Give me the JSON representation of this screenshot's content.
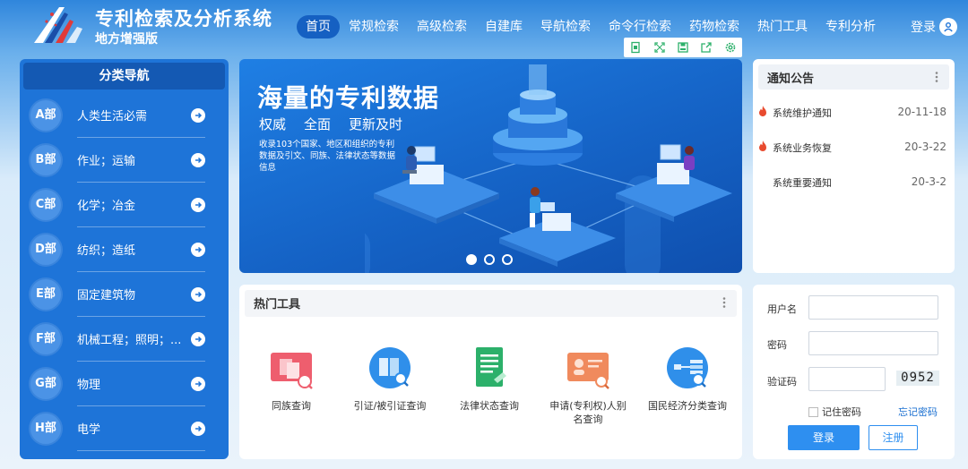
{
  "app": {
    "title": "专利检索及分析系统",
    "subtitle": "地方增强版"
  },
  "nav": {
    "items": [
      "首页",
      "常规检索",
      "高级检索",
      "自建库",
      "导航检索",
      "命令行检索",
      "药物检索",
      "热门工具",
      "专利分析"
    ],
    "active": "首页",
    "login_label": "登录"
  },
  "toolbar": {
    "icons": [
      "page-icon",
      "expand-icon",
      "save-icon",
      "share-icon",
      "settings-icon"
    ]
  },
  "sidebar": {
    "title": "分类导航",
    "items": [
      {
        "badge": "A部",
        "label": "人类生活必需"
      },
      {
        "badge": "B部",
        "label": "作业；运输"
      },
      {
        "badge": "C部",
        "label": "化学；冶金"
      },
      {
        "badge": "D部",
        "label": "纺织；造纸"
      },
      {
        "badge": "E部",
        "label": "固定建筑物"
      },
      {
        "badge": "F部",
        "label": "机械工程；照明；..."
      },
      {
        "badge": "G部",
        "label": "物理"
      },
      {
        "badge": "H部",
        "label": "电学"
      }
    ]
  },
  "banner": {
    "headline": "海量的专利数据",
    "tags": [
      "权威",
      "全面",
      "更新及时"
    ],
    "description": "收录103个国家、地区和组织的专利数据及引文、同族、法律状态等数据信息",
    "slides": 3,
    "active_slide": 1
  },
  "notice": {
    "title": "通知公告",
    "items": [
      {
        "text": "系统维护通知",
        "date": "20-11-18",
        "hot": true
      },
      {
        "text": "系统业务恢复",
        "date": "20-3-22",
        "hot": true
      },
      {
        "text": "系统重要通知",
        "date": "20-3-2",
        "hot": false
      }
    ]
  },
  "tools": {
    "title": "热门工具",
    "items": [
      {
        "label": "同族查询",
        "icon": "family-search-icon",
        "color": "#ee5e6e"
      },
      {
        "label": "引证/被引证查询",
        "icon": "citation-search-icon",
        "color": "#2f8fea"
      },
      {
        "label": "法律状态查询",
        "icon": "legal-status-icon",
        "color": "#2cb06a"
      },
      {
        "label": "申请(专利权)人别名查询",
        "icon": "applicant-alias-icon",
        "color": "#f08a5d"
      },
      {
        "label": "国民经济分类查询",
        "icon": "economy-class-icon",
        "color": "#2f8fea"
      }
    ]
  },
  "login": {
    "username_label": "用户名",
    "username_value": "",
    "password_label": "密码",
    "password_value": "",
    "captcha_label": "验证码",
    "captcha_value": "",
    "captcha_code": "0952",
    "remember_label": "记住密码",
    "forgot_label": "忘记密码",
    "login_button": "登录",
    "register_button": "注册"
  },
  "colors": {
    "primary": "#1e74d8",
    "nav_active": "#1560c2",
    "button": "#2e8ff0",
    "hot": "#e84b2f"
  }
}
